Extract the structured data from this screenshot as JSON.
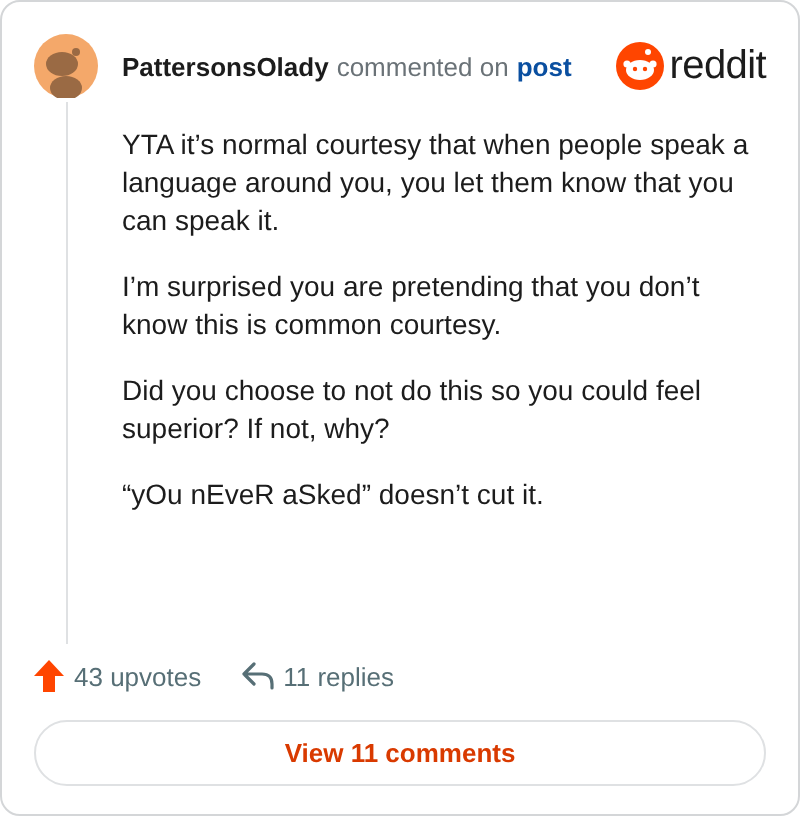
{
  "comment": {
    "author": "PattersonsOlady",
    "action": "commented on",
    "link": "post"
  },
  "brand": "reddit",
  "paragraphs": [
    "YTA it’s normal courtesy that when people speak a language around you, you let them know that you can speak it.",
    "I’m surprised you are pretending that you don’t know this is common courtesy.",
    "Did you choose to not do this so you could feel superior? If not, why?",
    "“yOu nEveR aSked” doesn’t cut it."
  ],
  "upvotes": "43 upvotes",
  "replies": "11 replies",
  "view_button": "View 11 comments"
}
